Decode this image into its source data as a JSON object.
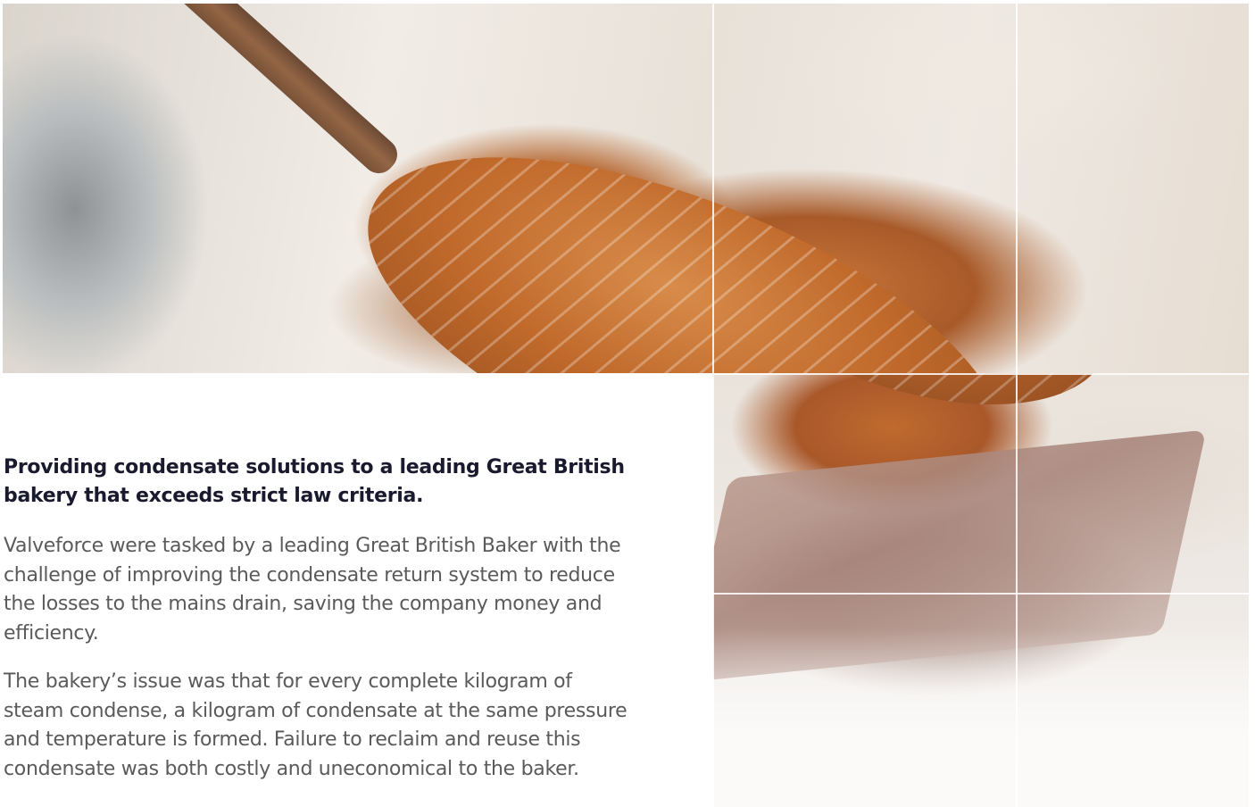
{
  "article": {
    "headline": "Providing condensate solutions to a leading Great British bakery that exceeds strict law criteria.",
    "paragraphs": [
      "Valveforce were tasked by a leading Great British Baker with the challenge of improving the condensate return system to reduce the losses to the mains drain, saving the company money and efficiency.",
      "The bakery’s issue was that for every complete kilogram of steam condense, a kilogram of condensate at the same pressure and temperature is formed. Failure to reclaim and reuse this condensate was both costly and uneconomical to the baker."
    ]
  }
}
